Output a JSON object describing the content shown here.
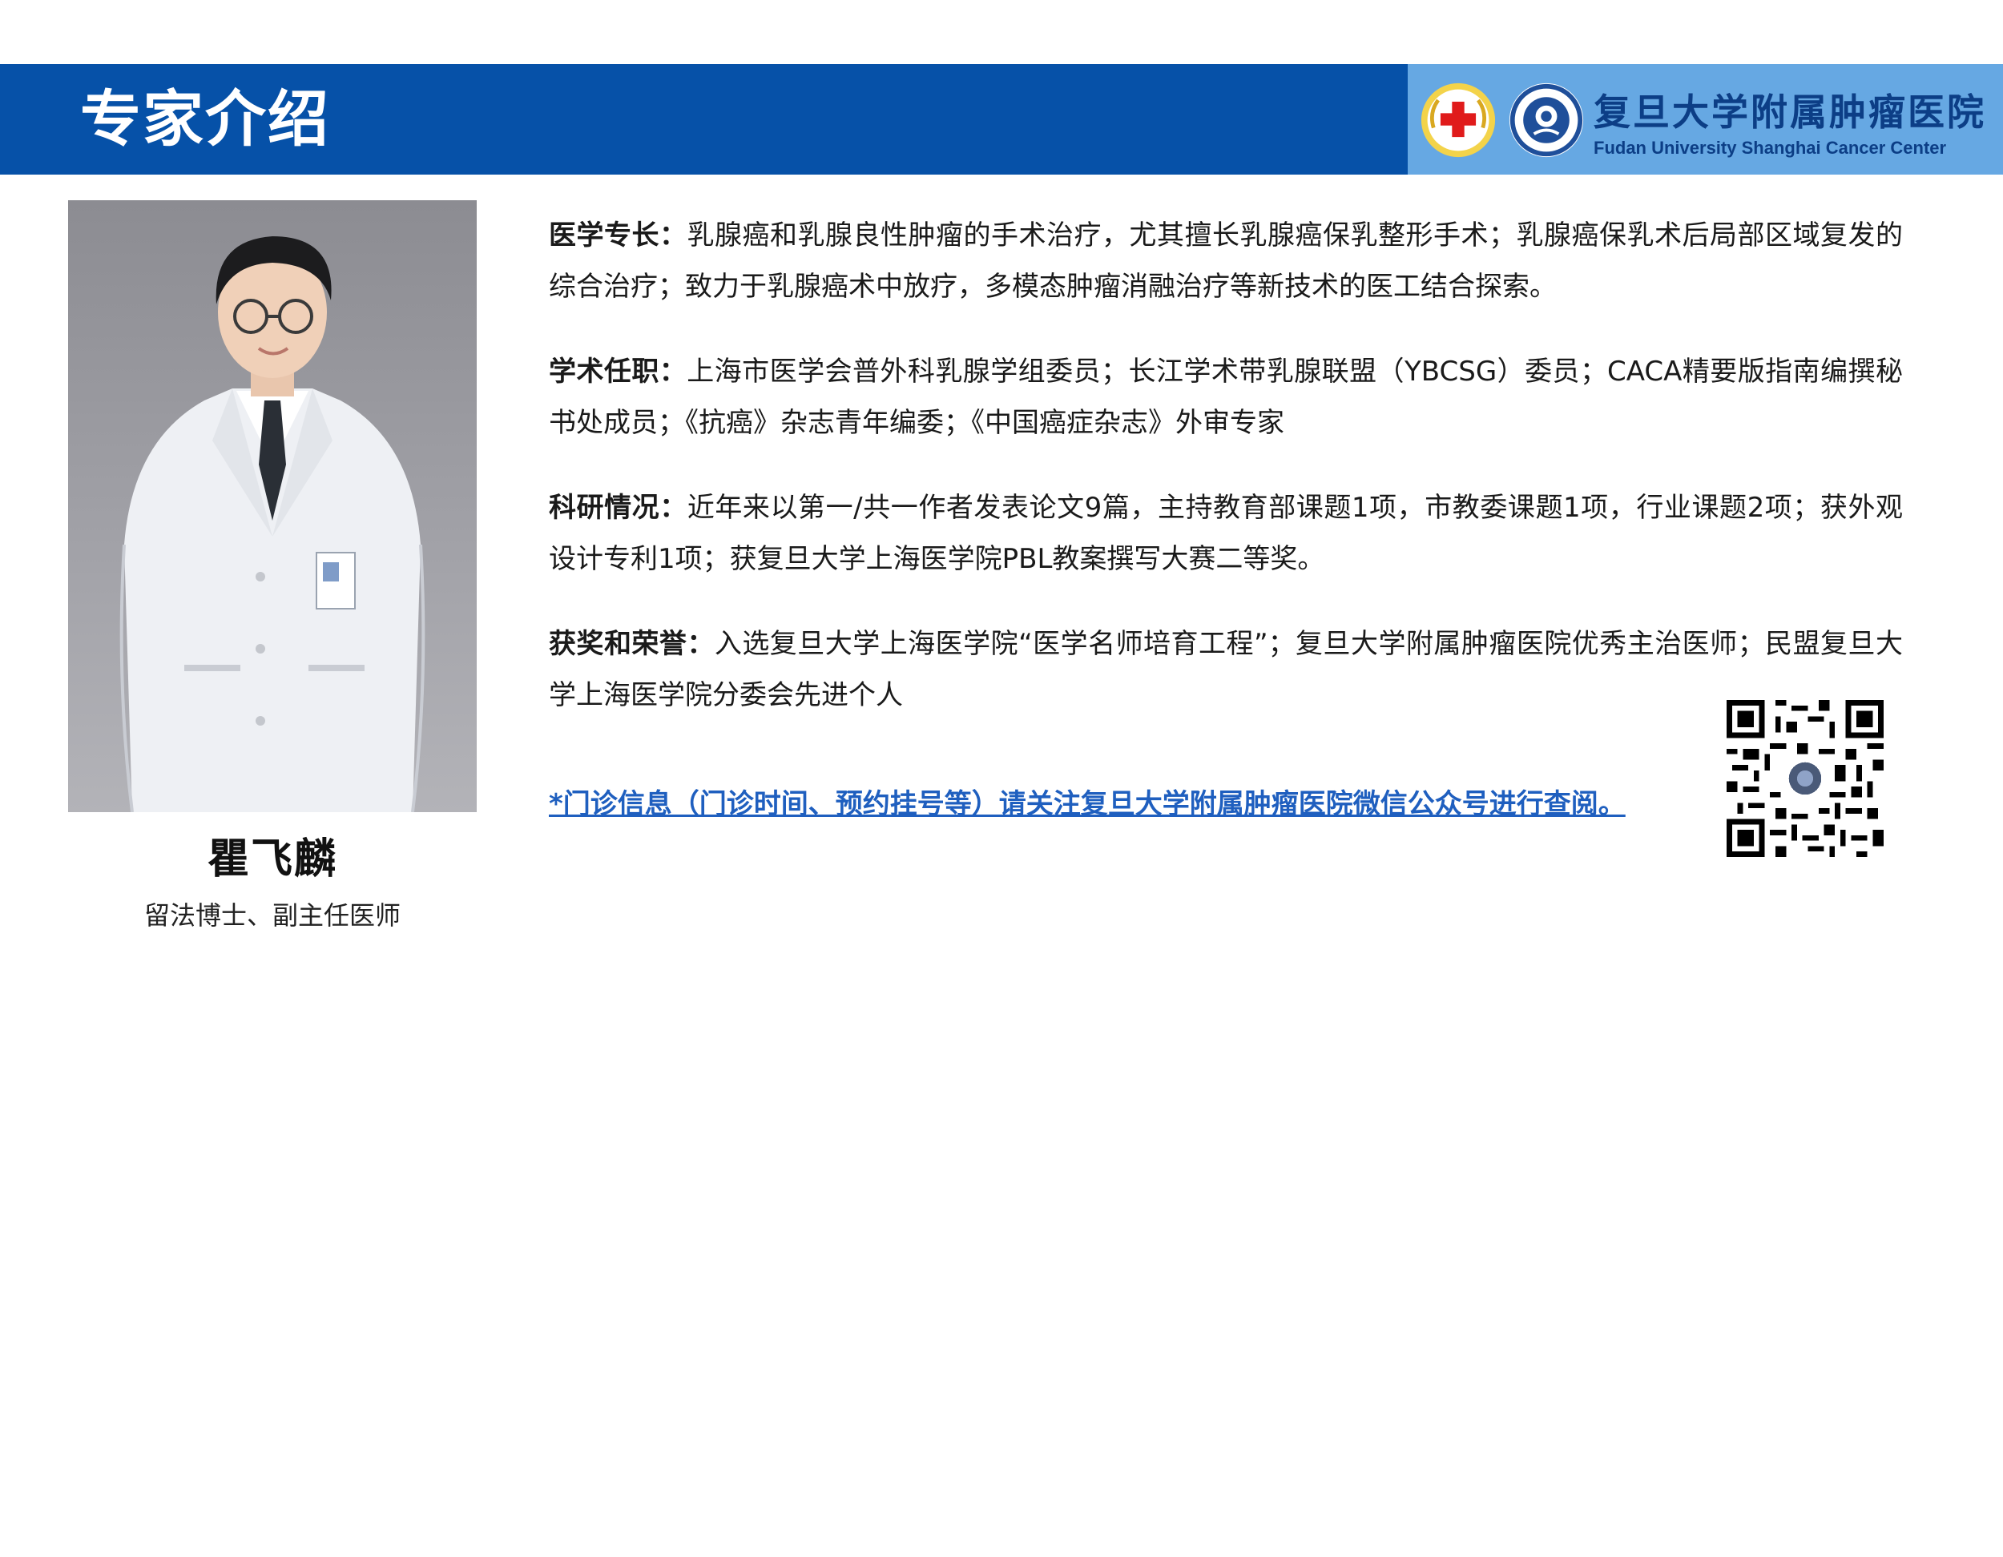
{
  "header": {
    "title": "专家介绍",
    "logo_cn": "复旦大学附属肿瘤医院",
    "logo_en": "Fudan University Shanghai Cancer Center",
    "bar_color": "#0651a8",
    "logo_panel_color": "#66a8e3"
  },
  "doctor": {
    "name": "瞿飞麟",
    "title": "留法博士、副主任医师"
  },
  "sections": [
    {
      "label": "医学专长：",
      "text": "乳腺癌和乳腺良性肿瘤的手术治疗，尤其擅长乳腺癌保乳整形手术；乳腺癌保乳术后局部区域复发的综合治疗；致力于乳腺癌术中放疗，多模态肿瘤消融治疗等新技术的医工结合探索。"
    },
    {
      "label": "学术任职：",
      "text": "上海市医学会普外科乳腺学组委员；长江学术带乳腺联盟（YBCSG）委员；CACA精要版指南编撰秘书处成员；《抗癌》杂志青年编委；《中国癌症杂志》外审专家"
    },
    {
      "label": "科研情况：",
      "text": "近年来以第一/共一作者发表论文9篇，主持教育部课题1项，市教委课题1项，行业课题2项；获外观设计专利1项；获复旦大学上海医学院PBL教案撰写大赛二等奖。"
    },
    {
      "label": "获奖和荣誉：",
      "text": "入选复旦大学上海医学院“医学名师培育工程”；复旦大学附属肿瘤医院优秀主治医师；民盟复旦大学上海医学院分委会先进个人"
    }
  ],
  "notice": "*门诊信息（门诊时间、预约挂号等）请关注复旦大学附属肿瘤医院微信公众号进行查阅。",
  "icons": {
    "red_cross": "red-cross-emblem-icon",
    "hospital_emblem": "hospital-emblem-icon",
    "qr": "wechat-qr-code-icon"
  }
}
